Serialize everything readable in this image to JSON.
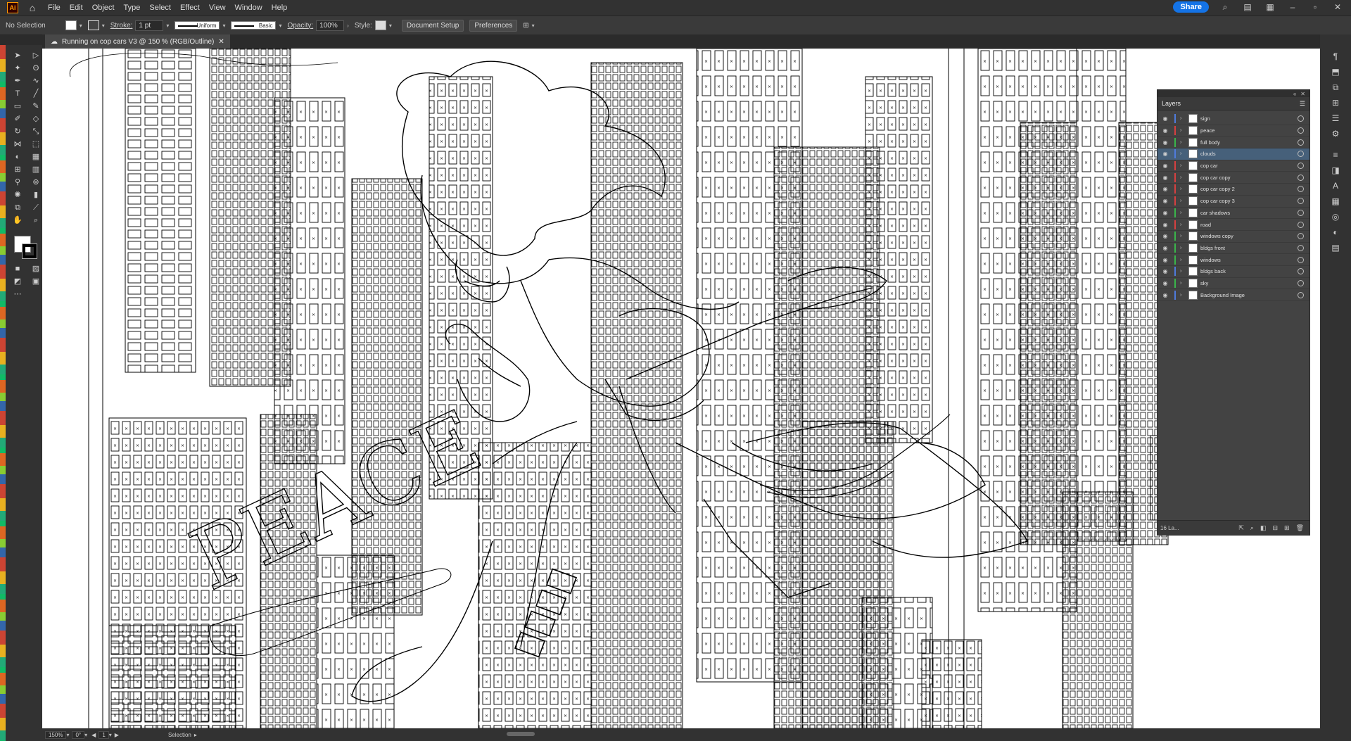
{
  "app": {
    "logo": "Ai",
    "menu": [
      "File",
      "Edit",
      "Object",
      "Type",
      "Select",
      "Effect",
      "View",
      "Window",
      "Help"
    ],
    "share_label": "Share"
  },
  "control_bar": {
    "selection_status": "No Selection",
    "stroke_label": "Stroke:",
    "stroke_weight": "1 pt",
    "stroke_profile": "Uniform",
    "brush": "Basic",
    "opacity_label": "Opacity:",
    "opacity_value": "100%",
    "style_label": "Style:",
    "document_setup": "Document Setup",
    "preferences": "Preferences"
  },
  "document": {
    "tab_title": "Running on cop cars V3 @ 150 % (RGB/Outline)"
  },
  "layers_panel": {
    "title": "Layers",
    "count_label": "16 La...",
    "layers": [
      {
        "name": "sign",
        "color": "#4f7bdc",
        "selected": false
      },
      {
        "name": "peace",
        "color": "#d64040",
        "selected": false
      },
      {
        "name": "full body",
        "color": "#3ab54a",
        "selected": false
      },
      {
        "name": "clouds",
        "color": "#4f7bdc",
        "selected": true
      },
      {
        "name": "cop car",
        "color": "#d64040",
        "selected": false
      },
      {
        "name": "cop car copy",
        "color": "#d64040",
        "selected": false
      },
      {
        "name": "cop car copy 2",
        "color": "#d64040",
        "selected": false
      },
      {
        "name": "cop car copy 3",
        "color": "#d64040",
        "selected": false
      },
      {
        "name": "car shadows",
        "color": "#3ab54a",
        "selected": false
      },
      {
        "name": "road",
        "color": "#d64040",
        "selected": false
      },
      {
        "name": "windows copy",
        "color": "#3ab54a",
        "selected": false
      },
      {
        "name": "bldgs front",
        "color": "#3ab54a",
        "selected": false
      },
      {
        "name": "windows",
        "color": "#3ab54a",
        "selected": false
      },
      {
        "name": "bldgs back",
        "color": "#4f7bdc",
        "selected": false
      },
      {
        "name": "sky",
        "color": "#3ab54a",
        "selected": false
      },
      {
        "name": "Background Image",
        "color": "#4f7bdc",
        "selected": false
      }
    ]
  },
  "status_bar": {
    "zoom": "150%",
    "rotation": "0°",
    "artboard": "1",
    "tool": "Selection"
  },
  "artwork": {
    "lettering": "PEACE"
  }
}
